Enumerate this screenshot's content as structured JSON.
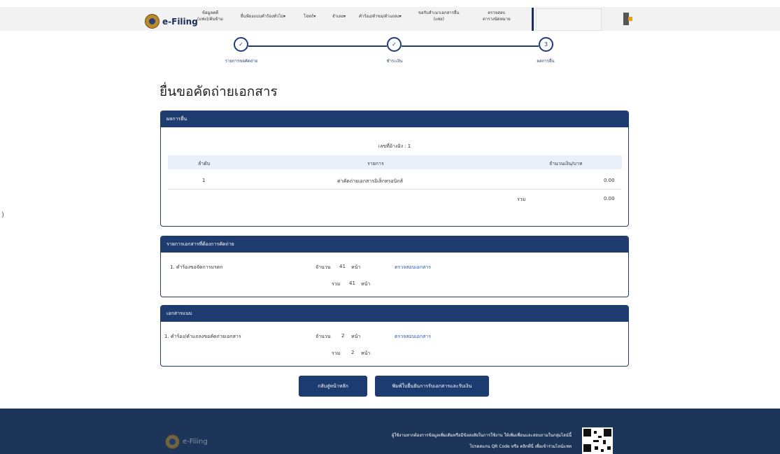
{
  "header": {
    "logo_text": "e-Filing",
    "nav": [
      {
        "line1": "ข้อมูลคดี",
        "line2": "(แพ่ง)/ค้นข้าม"
      },
      {
        "line1": "ยื่นฟ้องแบบคำร้องทั่วไป▾"
      },
      {
        "line1": "โจทก์▾"
      },
      {
        "line1": "จำเลย▾"
      },
      {
        "line1": "คำร้อง/คำขอ/คำแถลง▾"
      },
      {
        "line1": "ขอรับสำเนาเอกสารยื่น",
        "line2": "(แพ่ง)"
      },
      {
        "line1": "ตรวจสอบ",
        "line2": "ตารางนัดหมาย"
      }
    ]
  },
  "steps": [
    {
      "mark": "✓",
      "label": "รายการขอคัดถ่าย"
    },
    {
      "mark": "✓",
      "label": "ชำระเงิน"
    },
    {
      "mark": "3",
      "label": "ผลการยื่น"
    }
  ],
  "page_title": "ยื่นขอคัดถ่ายเอกสาร",
  "result_panel": {
    "title": "ผลการยื่น",
    "receipt_no": "เลขที่อ้างอิง : 1",
    "columns": [
      "ลำดับ",
      "รายการ",
      "จำนวนเงิน/บาท"
    ],
    "rows": [
      {
        "no": "1",
        "item": "ค่าคัดถ่ายเอกสารอิเล็กทรอนิกส์",
        "amount": "0.00"
      }
    ],
    "total_label": "รวม",
    "total_amount": "0.00"
  },
  "documents_panel": {
    "title": "รายการเอกสารที่ต้องการคัดถ่าย",
    "items": [
      {
        "name": "1. คำร้องขอจัดการมรดก",
        "count_label": "จำนวน",
        "count": "41",
        "unit": "หน้า",
        "link": "ตรวจสอบเอกสาร",
        "sum_label": "รวม",
        "sum": "41",
        "sum_unit": "หน้า"
      }
    ]
  },
  "attachments_panel": {
    "title": "เอกสารแนบ",
    "items": [
      {
        "name": "1. คำร้อง/คำแถลงขอคัดถ่ายเอกสาร",
        "count_label": "จำนวน",
        "count": "2",
        "unit": "หน้า",
        "link": "ตรวจสอบเอกสาร",
        "sum_label": "รวม",
        "sum": "2",
        "sum_unit": "หน้า"
      }
    ]
  },
  "buttons": {
    "home": "กลับสู่หน้าหลัก",
    "print": "พิมพ์ใบยื่นยันการรับเอกสารและรับเงิน"
  },
  "footer": {
    "logo_text": "e-Filing",
    "line1": "ผู้ใช้งานหากต้องการข้อมูลเพิ่มเติมหรือมีข้อสงสัยในการใช้งาน ให้เพิ่มเพื่อนและสอบถามในกลุ่มไลน์นี้",
    "line2": "โปรดสแกน QR Code หรือ คลิกที่นี่ เพื่อเข้าร่วมไลน์แชท"
  },
  "colors": {
    "primary": "#1e3c6f",
    "footer": "#1c3559",
    "link": "#2a56b5",
    "table_header": "#eaf0fb"
  }
}
